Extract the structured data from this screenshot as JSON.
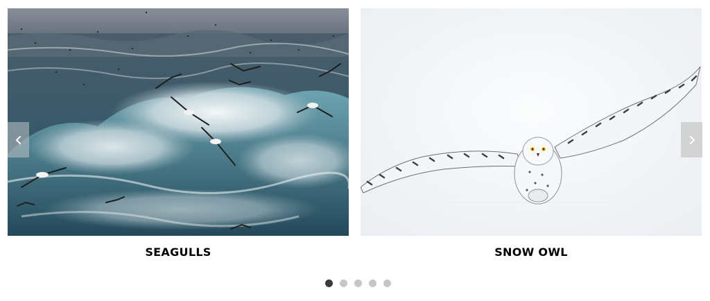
{
  "carousel": {
    "slides": [
      {
        "caption": "SEAGULLS",
        "image": "seagulls-over-stormy-ocean"
      },
      {
        "caption": "SNOW OWL",
        "image": "snowy-owl-in-flight"
      }
    ],
    "prev_icon": "chevron-left-icon",
    "next_icon": "chevron-right-icon",
    "pagination": {
      "count": 5,
      "active_index": 1
    },
    "colors": {
      "dot_active": "#3a3a3a",
      "dot_inactive": "#c6c6c6",
      "caption": "#000000"
    }
  }
}
